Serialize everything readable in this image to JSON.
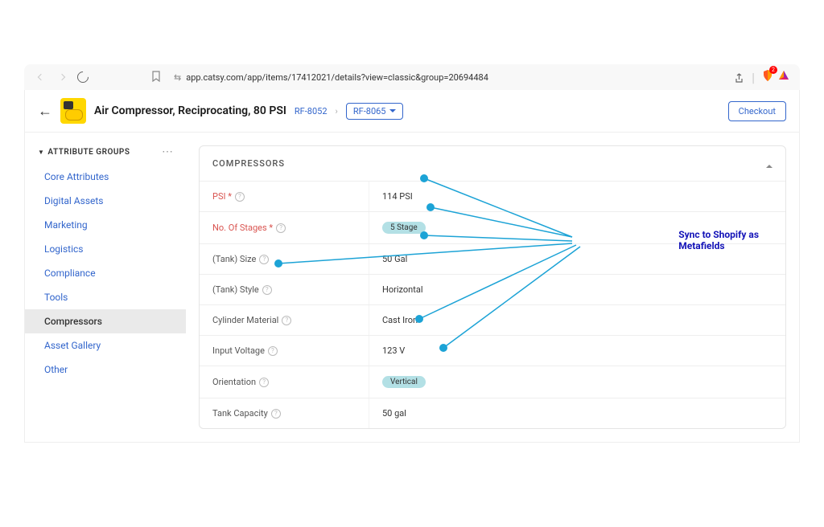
{
  "browser": {
    "url": "app.catsy.com/app/items/17412021/details?view=classic&group=20694484",
    "shield_count": "2"
  },
  "header": {
    "title": "Air Compressor, Reciprocating, 80 PSI",
    "breadcrumb_link": "RF-8052",
    "breadcrumb_current": "RF-8065",
    "checkout_label": "Checkout"
  },
  "sidebar": {
    "title": "ATTRIBUTE GROUPS",
    "items": [
      {
        "label": "Core Attributes"
      },
      {
        "label": "Digital Assets"
      },
      {
        "label": "Marketing"
      },
      {
        "label": "Logistics"
      },
      {
        "label": "Compliance"
      },
      {
        "label": "Tools"
      },
      {
        "label": "Compressors"
      },
      {
        "label": "Asset Gallery"
      },
      {
        "label": "Other"
      }
    ]
  },
  "panel": {
    "title": "COMPRESSORS",
    "rows": [
      {
        "label": "PSI *",
        "value": "114 PSI",
        "required": true,
        "pill": false
      },
      {
        "label": "No. Of Stages *",
        "value": "5 Stage",
        "required": true,
        "pill": true
      },
      {
        "label": "(Tank) Size",
        "value": "50 Gal",
        "required": false,
        "pill": false
      },
      {
        "label": "(Tank) Style",
        "value": "Horizontal",
        "required": false,
        "pill": false
      },
      {
        "label": "Cylinder Material",
        "value": "Cast Iron",
        "required": false,
        "pill": false
      },
      {
        "label": "Input Voltage",
        "value": "123 V",
        "required": false,
        "pill": false
      },
      {
        "label": "Orientation",
        "value": "Vertical",
        "required": false,
        "pill": true
      },
      {
        "label": "Tank Capacity",
        "value": "50 gal",
        "required": false,
        "pill": false
      }
    ]
  },
  "annotation": {
    "line1": "Sync to Shopify as",
    "line2": "Metafields"
  }
}
